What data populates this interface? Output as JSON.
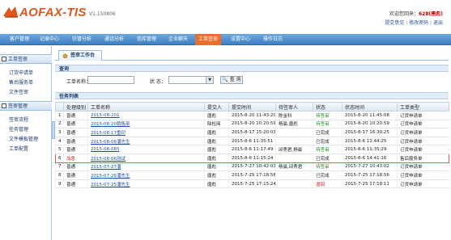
{
  "header": {
    "logo_text": "AOFAX-TIS",
    "version": "V1.150806",
    "welcome_prefix": "欢迎您回来：",
    "user": "628(唐彪)",
    "link_feedback": "提交意见",
    "link_sep1": "|",
    "link_password": "修改密码",
    "link_sep2": "|",
    "link_logout": "退出"
  },
  "nav": {
    "items": [
      "客户管理",
      "记录中心",
      "仿冒分析",
      "通话分析",
      "信库管理",
      "企业聊天",
      "工单签审",
      "设置中心",
      "操作日志"
    ],
    "active_index": 6
  },
  "sidebar": {
    "groups": [
      {
        "title": "工单签审",
        "items": [
          "订货申请单",
          "售后服务单",
          "文件签审"
        ]
      },
      {
        "title": "签审管理",
        "items": [
          "签审流程",
          "任务管理",
          "文件模板管理",
          "工单配置"
        ]
      }
    ]
  },
  "tab": {
    "label": "签审工作台"
  },
  "query": {
    "section_title": "查询",
    "name_label": "工单名称：",
    "name_value": "",
    "status_label": "状 态：",
    "status_value": "",
    "button_label": "查 询"
  },
  "tasks": {
    "section_title": "任务列表",
    "columns": [
      "",
      "处理级别",
      "工单名称",
      "提交人",
      "提交时间",
      "待签审人",
      "状态",
      "状态时间",
      "工单类型"
    ],
    "rows": [
      [
        "1",
        "普通",
        "2015-08-201",
        "唐彪",
        "2015-8-20 11:43:20",
        "陈金科",
        "待签审",
        "2015-8-20 11:45:08",
        "订货申请单"
      ],
      [
        "2",
        "普通",
        "2015-08-20销售部",
        "陆检阅",
        "2015-8-20 10:20:59",
        "杨晨,唐彪",
        "待签审",
        "2015-8-20 10:20:59",
        "订货申请单"
      ],
      [
        "3",
        "普通",
        "2015-08-17重印",
        "唐彪",
        "2015-8-17 15:20:03",
        "",
        "已完成",
        "2015-8-17 16:30:25",
        "订货申请单"
      ],
      [
        "4",
        "普通",
        "2015-08-06潘先生",
        "唐彪",
        "2015-8-6 11:35:51",
        "",
        "已完成",
        "2015-8-6 11:44:25",
        "订货申请单"
      ],
      [
        "5",
        "普通",
        "2015-08-065",
        "唐彪",
        "2015-8-6 11:17:49",
        "邱秀君,杨晨",
        "待签审",
        "2015-8-6 11:35:29",
        "订货申请单"
      ],
      [
        "6",
        "加急",
        "2015-08-06测试",
        "唐彪",
        "2015-8-6 11:15:24",
        "",
        "已完成",
        "2015-8-6 14:41:16",
        "售后服务单"
      ],
      [
        "7",
        "普通",
        "2015-07-27潘",
        "唐彪",
        "2015-7-27 10:42:03",
        "杨晨,邱秀君",
        "待签审",
        "2015-7-27 10:43:02",
        "订货申请单"
      ],
      [
        "8",
        "普通",
        "2015-07-25潘先生",
        "唐彪",
        "2015-7-25 17:18:56",
        "",
        "已完成",
        "2015-7-25 17:18:56",
        "订货申请单"
      ],
      [
        "9",
        "普通",
        "2015-07-25潘先生",
        "唐彪",
        "2015-7-25 17:15:24",
        "",
        "退回",
        "2015-7-25 17:18:11",
        "订货申请单"
      ]
    ],
    "highlight_row": 5
  },
  "colors": {
    "nav_gradient_top": "#6ea8dc",
    "nav_gradient_bottom": "#3d7fc4",
    "nav_active": "#e96f2b",
    "logo": "#e0541e",
    "link": "#1f4f9e",
    "status_pending": "#1f8a2a",
    "status_returned": "#d11f1f",
    "highlight": "#e25656"
  },
  "icons": {
    "logo": "aofax-logo-mark",
    "tab": "home-icon",
    "sidebar_toggle": "minus-box-icon",
    "select": "chevron-down-icon",
    "search_button": "search-icon"
  }
}
